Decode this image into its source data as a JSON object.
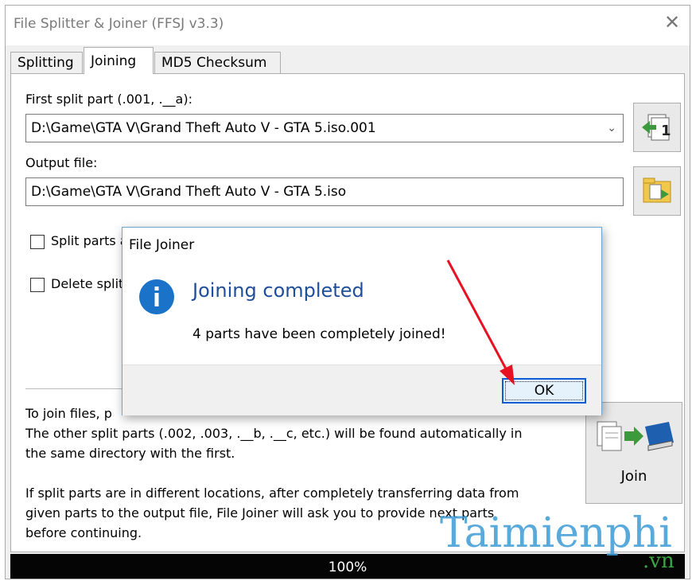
{
  "window": {
    "title": "File Splitter & Joiner (FFSJ v3.3)",
    "close_glyph": "✕"
  },
  "tabs": [
    {
      "label": "Splitting",
      "active": false
    },
    {
      "label": "Joining",
      "active": true
    },
    {
      "label": "MD5 Checksum",
      "active": false
    }
  ],
  "joining": {
    "first_part_label": "First split part (.001, .__a):",
    "first_part_value": "D:\\Game\\GTA V\\Grand Theft Auto V - GTA 5.iso.001",
    "output_label": "Output file:",
    "output_value": "D:\\Game\\GTA V\\Grand Theft Auto V - GTA 5.iso",
    "check1_label": "Split parts a",
    "check1_checked": false,
    "check2_label": "Delete split",
    "check2_checked": false,
    "help_lines": [
      "To join files, p",
      "The other split parts (.002, .003, .__b, .__c, etc.) will be found automatically in",
      "the same directory with the first.",
      "",
      "If split parts are in different locations, after completely transferring data from",
      "given parts to the output file, File Joiner will ask you to provide next parts",
      "before continuing."
    ],
    "join_button_label": "Join",
    "icons": {
      "browse_first": "split-file-icon",
      "browse_output": "folder-icon",
      "join": "join-books-icon"
    }
  },
  "progress": {
    "percent": 100,
    "text": "100%"
  },
  "dialog": {
    "title": "File Joiner",
    "heading": "Joining completed",
    "message": "4 parts have been completely joined!",
    "ok_label": "OK",
    "icon": "info-icon"
  },
  "watermark": {
    "main": "Taimienphi",
    "suffix": ".vn"
  },
  "colors": {
    "accent_blue": "#1f4e9a",
    "annotation_red": "#e81123",
    "ok_border": "#0b5cd5",
    "info_blue": "#1a73c8"
  }
}
